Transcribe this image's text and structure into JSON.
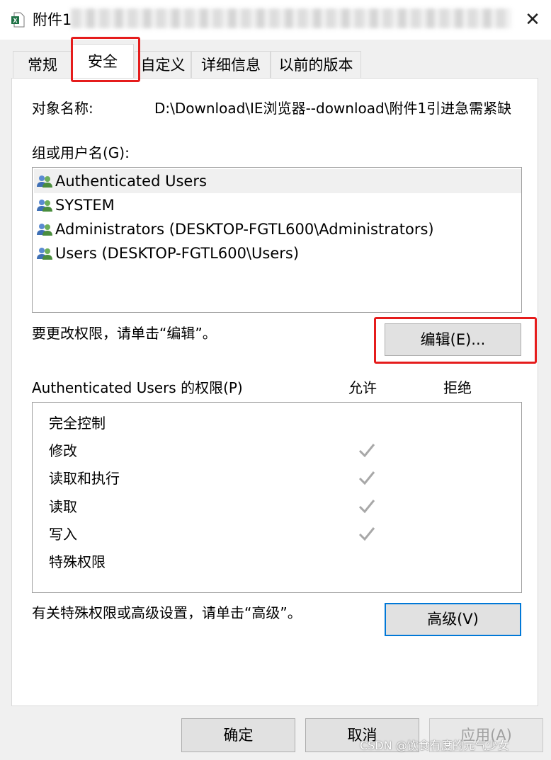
{
  "window": {
    "title": "附件1",
    "close_glyph": "✕",
    "app_icon": "excel-file-icon"
  },
  "tabs": [
    {
      "label": "常规"
    },
    {
      "label": "安全"
    },
    {
      "label": "自定义"
    },
    {
      "label": "详细信息"
    },
    {
      "label": "以前的版本"
    }
  ],
  "security": {
    "object_name_label": "对象名称:",
    "object_name_value": "D:\\Download\\IE浏览器--download\\附件1引进急需紧缺",
    "groups_label": "组或用户名(G):",
    "users": [
      {
        "name": "Authenticated Users"
      },
      {
        "name": "SYSTEM"
      },
      {
        "name": "Administrators (DESKTOP-FGTL600\\Administrators)"
      },
      {
        "name": "Users (DESKTOP-FGTL600\\Users)"
      }
    ],
    "change_hint": "要更改权限，请单击“编辑”。",
    "edit_button": "编辑(E)...",
    "permissions_label": "Authenticated Users 的权限(P)",
    "allow_header": "允许",
    "deny_header": "拒绝",
    "permissions": [
      {
        "name": "完全控制",
        "allow": false
      },
      {
        "name": "修改",
        "allow": true
      },
      {
        "name": "读取和执行",
        "allow": true
      },
      {
        "name": "读取",
        "allow": true
      },
      {
        "name": "写入",
        "allow": true
      },
      {
        "name": "特殊权限",
        "allow": false
      }
    ],
    "advanced_hint": "有关特殊权限或高级设置，请单击“高级”。",
    "advanced_button": "高级(V)"
  },
  "footer": {
    "ok": "确定",
    "cancel": "取消",
    "apply": "应用(A)"
  },
  "watermark": "CSDN @饮食有度的元气少女",
  "colors": {
    "highlight_box": "#e51c1c",
    "focus_border": "#0078d7",
    "check": "#a8a8a8"
  }
}
